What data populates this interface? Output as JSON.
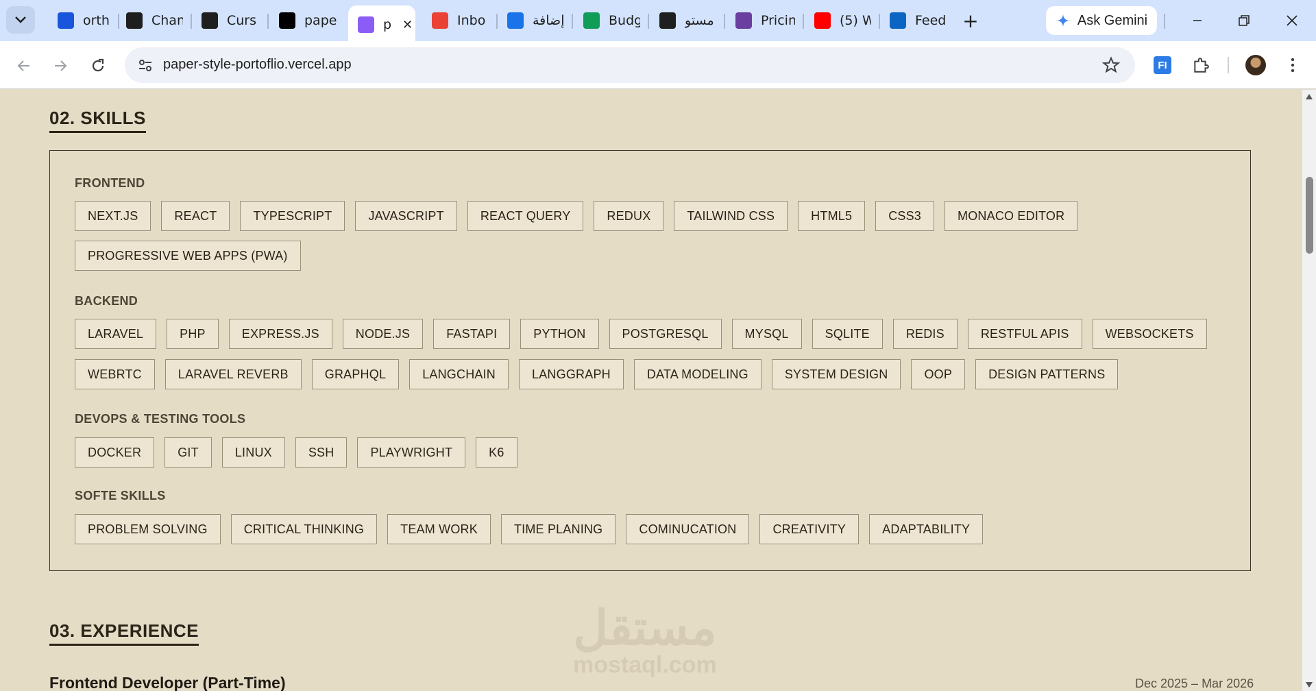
{
  "browser": {
    "tabs": [
      {
        "label": "ortho",
        "icon": "blue-b-icon",
        "color": "#1a56db"
      },
      {
        "label": "Chan",
        "icon": "github-icon",
        "color": "#1f1f1f"
      },
      {
        "label": "Curs",
        "icon": "cursor-icon",
        "color": "#1f1f1f"
      },
      {
        "label": "pape",
        "icon": "vercel-icon",
        "color": "#000000"
      },
      {
        "label": "p",
        "icon": "bolt-icon",
        "color": "#8b5cf6",
        "active": true
      },
      {
        "label": "Inbo",
        "icon": "gmail-icon",
        "color": "#ea4335"
      },
      {
        "label": "إضافة",
        "icon": "circle-icon",
        "color": "#1a73e8"
      },
      {
        "label": "Budg",
        "icon": "sheets-icon",
        "color": "#0f9d58"
      },
      {
        "label": "مستو",
        "icon": "openai-icon",
        "color": "#1f1f1f"
      },
      {
        "label": "Pricin",
        "icon": "pricing-icon",
        "color": "#6b3fa0"
      },
      {
        "label": "(5) W",
        "icon": "youtube-icon",
        "color": "#ff0000"
      },
      {
        "label": "Feed",
        "icon": "linkedin-icon",
        "color": "#0a66c2"
      }
    ],
    "gemini_label": "Ask Gemini",
    "url": "paper-style-portoflio.vercel.app"
  },
  "page": {
    "skills_heading": "02. SKILLS",
    "categories": [
      {
        "title": "FRONTEND",
        "rows": [
          [
            "NEXT.JS",
            "REACT",
            "TYPESCRIPT",
            "JAVASCRIPT",
            "REACT QUERY",
            "REDUX",
            "TAILWIND CSS",
            "HTML5",
            "CSS3",
            "MONACO EDITOR"
          ],
          [
            "PROGRESSIVE WEB APPS (PWA)"
          ]
        ]
      },
      {
        "title": "BACKEND",
        "rows": [
          [
            "LARAVEL",
            "PHP",
            "EXPRESS.JS",
            "NODE.JS",
            "FASTAPI",
            "PYTHON",
            "POSTGRESQL",
            "MYSQL",
            "SQLITE",
            "REDIS",
            "RESTFUL APIS",
            "WEBSOCKETS"
          ],
          [
            "WEBRTC",
            "LARAVEL REVERB",
            "GRAPHQL",
            "LANGCHAIN",
            "LANGGRAPH",
            "DATA MODELING",
            "SYSTEM DESIGN",
            "OOP",
            "DESIGN PATTERNS"
          ]
        ]
      },
      {
        "title": "DEVOPS & TESTING TOOLS",
        "rows": [
          [
            "DOCKER",
            "GIT",
            "LINUX",
            "SSH",
            "PLAYWRIGHT",
            "K6"
          ]
        ]
      },
      {
        "title": "SOFTE SKILLS",
        "rows": [
          [
            "PROBLEM SOLVING",
            "CRITICAL THINKING",
            "TEAM WORK",
            "TIME PLANING",
            "COMINUCATION",
            "CREATIVITY",
            "ADAPTABILITY"
          ]
        ]
      }
    ],
    "experience_heading": "03. EXPERIENCE",
    "job_title": "Frontend Developer (Part-Time)",
    "job_date": "Dec 2025 – Mar 2026",
    "watermark_ar": "مستقل",
    "watermark_en": "mostaql.com"
  }
}
